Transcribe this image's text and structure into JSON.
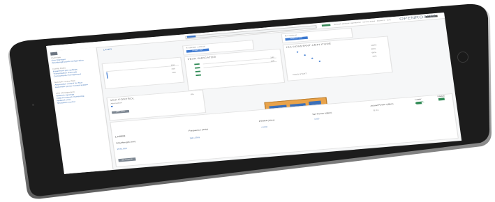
{
  "app": {
    "brand": "OPENROADM",
    "search_placeholder": "",
    "status_text": "Network element: operational · service active · alarms 0 · sync",
    "crumb": "LASER"
  },
  "sidebar": {
    "groups": [
      {
        "label": "Overview",
        "items": [
          "Line Manager",
          "Wavelength ports configuration"
        ]
      },
      {
        "label": "Config Mode",
        "items": [
          "Equipment port settings",
          "Transmission channels",
          "Components management"
        ]
      },
      {
        "label": "Network control flow",
        "items": [
          "Attenuation control for Mux",
          "Automatic power control system"
        ]
      },
      {
        "label": "Link Management",
        "items": [
          "Network topology",
          "Optical network monitoring",
          "Network view",
          "Shutdown control"
        ]
      }
    ]
  },
  "panels": {
    "tx_panel": {
      "label": "Tx power control",
      "button": "LASER SET"
    },
    "rx_panel": {
      "label": "Rx control",
      "button": "APPLY TRIM"
    },
    "peak_indicator": {
      "title": "PEAK INDICATOR"
    },
    "isa_amplitude": {
      "title": "ISA CONSTANT AMPLITUDE",
      "values": [
        "100%",
        "80%",
        "60%",
        "40%"
      ],
      "footer": "COLD START"
    },
    "left_values": [
      "100",
      "100",
      "100"
    ],
    "peak_values": [
      "100",
      "100"
    ],
    "vga_control": {
      "title": "VGA CONTROL",
      "subtitle": "Attenuation",
      "value": "0%",
      "button": "SET VGA"
    }
  },
  "laser": {
    "section_title": "LASER",
    "headers": {
      "wavelength": "Wavelength (nm)",
      "frequency": "Frequency (THz)",
      "fwhm": "FWHM (GHz)",
      "set_power": "Set Power (dBm)",
      "actual_power": "Actual Power (dBm)",
      "laser": "Laser",
      "status": "Status"
    },
    "values": {
      "wavelength": "1574.000",
      "frequency": "190.4709",
      "fwhm": "0.000",
      "set_power": "0.00",
      "actual_power": "-5.01"
    },
    "status_label": "ON",
    "settings_button": "SETTINGS"
  },
  "colors": {
    "accent": "#3b78d0",
    "ok": "#2f8a55",
    "diagram": "#e9a34a",
    "bezel": "#1c1c1c"
  }
}
